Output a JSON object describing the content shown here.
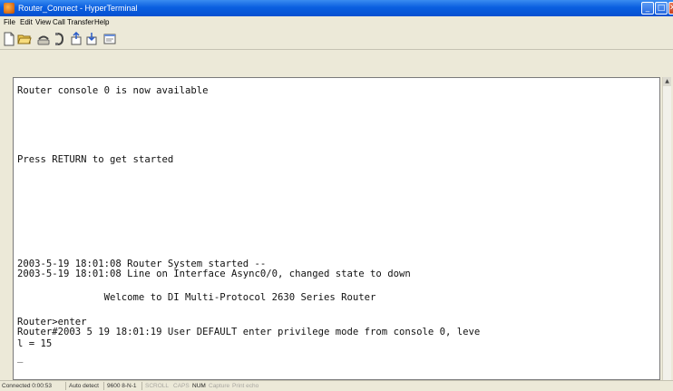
{
  "window": {
    "title": "Router_Connect - HyperTerminal",
    "controls": {
      "minimize": "_",
      "maximize": "□",
      "close": "✕"
    }
  },
  "menu": {
    "items": [
      {
        "label": "File"
      },
      {
        "label": "Edit"
      },
      {
        "label": "View"
      },
      {
        "label": "Call"
      },
      {
        "label": "Transfer"
      },
      {
        "label": "Help"
      }
    ]
  },
  "toolbar": {
    "buttons": [
      {
        "icon": "new-document-icon"
      },
      {
        "icon": "open-folder-icon"
      },
      {
        "icon": "phone-call-icon"
      },
      {
        "icon": "disconnect-icon"
      },
      {
        "icon": "send-file-icon"
      },
      {
        "icon": "receive-file-icon"
      },
      {
        "icon": "properties-icon"
      }
    ]
  },
  "terminal": {
    "lines": [
      "Router console 0 is now available",
      "Press RETURN to get started",
      "2003-5-19 18:01:08 Router System started --",
      "2003-5-19 18:01:08 Line on Interface Async0/0, changed state to down",
      "               Welcome to DI Multi-Protocol 2630 Series Router",
      "Router>enter",
      "Router#2003 5 19 18:01:19 User DEFAULT enter privilege mode from console 0, leve",
      "l = 15",
      "_"
    ]
  },
  "status": {
    "connected": "Connected 0:00:53",
    "auto_detect": "Auto detect",
    "baud": "9600 8-N-1",
    "scroll": "SCROLL",
    "caps": "CAPS",
    "num": "NUM",
    "capture": "Capture",
    "print_echo": "Print echo"
  },
  "colors": {
    "titlebar": "#0a5fe0",
    "window_bg": "#ece9d8",
    "terminal_bg": "#ffffff",
    "terminal_text": "#111111"
  }
}
